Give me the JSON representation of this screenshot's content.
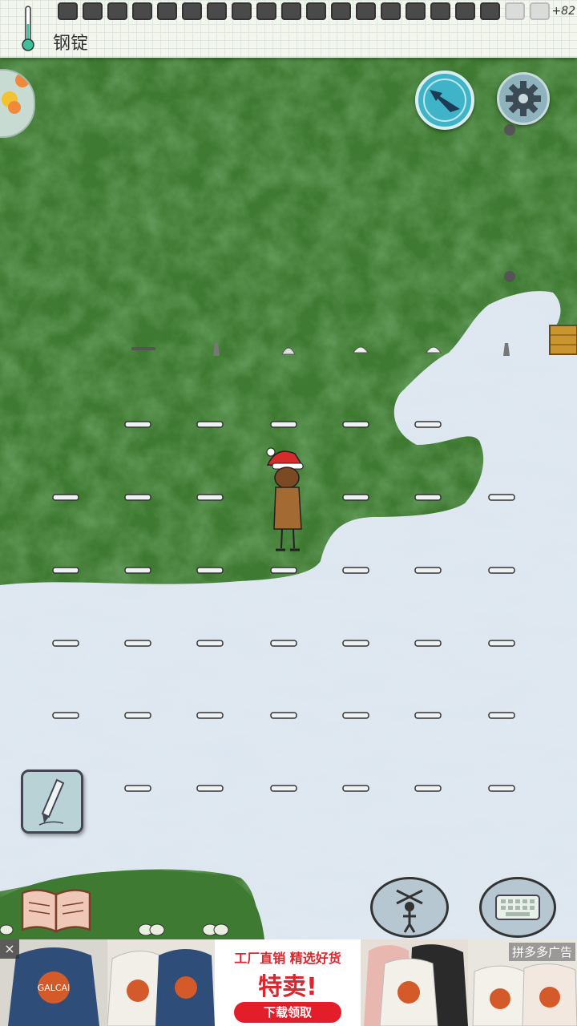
{
  "hud": {
    "held_item": "钢锭",
    "food_meter": {
      "filled": 18,
      "empty": 2
    },
    "yum_bonus": "+82"
  },
  "ad": {
    "tagline": "工厂直销 精选好货",
    "headline": "特卖!",
    "cta": "下载领取",
    "close": "×",
    "source": "拼多多广告",
    "brand_print": "GALCAI"
  },
  "icons": {
    "thermometer": "thermometer-icon",
    "compass": "compass-icon",
    "settings": "gear-icon",
    "pencil": "pencil-icon",
    "book": "book-icon",
    "puppet": "puppet-icon",
    "keyboard": "keyboard-icon"
  },
  "colors": {
    "grass": "#3f7a32",
    "snow": "#dfe8f0",
    "compass": "#3fb4c9",
    "ad_red": "#e31e2a"
  }
}
